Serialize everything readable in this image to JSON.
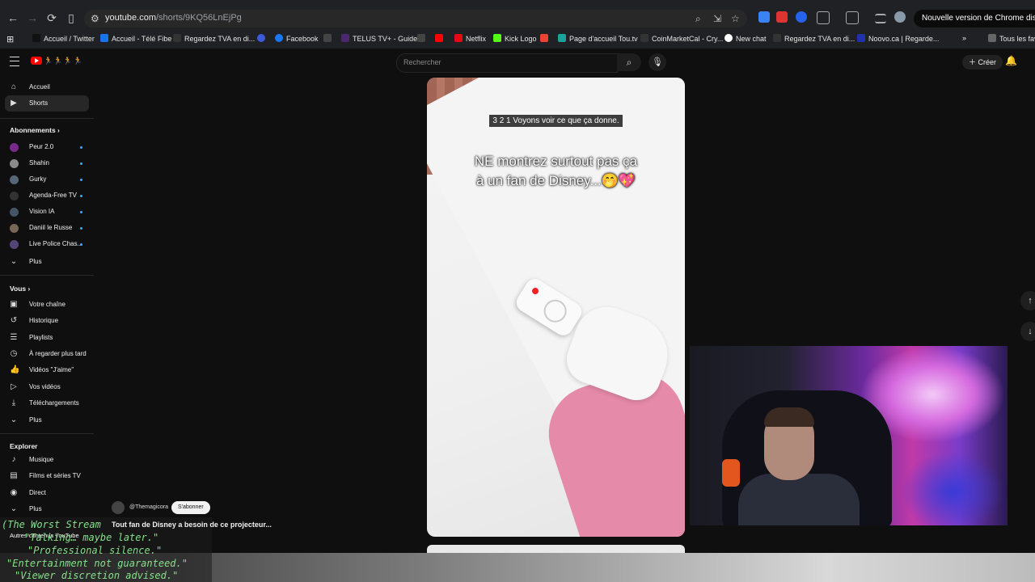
{
  "browser": {
    "url_host": "youtube.com",
    "url_path": "/shorts/9KQ56LnEjPg",
    "update_label": "Nouvelle version de Chrome disponible",
    "bookmarks": [
      {
        "label": "Accueil / Twitter",
        "color": "#111111"
      },
      {
        "label": "Accueil - Télé Fibe",
        "color": "#1a73e8"
      },
      {
        "label": "Regardez TVA en di...",
        "color": "#333333"
      },
      {
        "label": "Facebook",
        "color": "#1877f2"
      },
      {
        "label": "TELUS TV+ - Guide",
        "color": "#4b286d"
      },
      {
        "label": "Netflix",
        "color": "#e50914"
      },
      {
        "label": "Kick Logo",
        "color": "#53fc18"
      },
      {
        "label": "Page d'accueil Tou.tv",
        "color": "#1aa39a"
      },
      {
        "label": "CoinMarketCal - Cry...",
        "color": "#333333"
      },
      {
        "label": "New chat",
        "color": "#ffffff"
      },
      {
        "label": "Regardez TVA en di...",
        "color": "#333333"
      },
      {
        "label": "Noovo.ca | Regarde...",
        "color": "#2233aa"
      },
      {
        "label": "Tous les favo",
        "color": "#666666"
      }
    ]
  },
  "yt": {
    "search_placeholder": "Rechercher",
    "create_label": "Créer",
    "sidebar": {
      "main": [
        {
          "label": "Accueil",
          "icon": "home-icon"
        },
        {
          "label": "Shorts",
          "icon": "shorts-icon",
          "active": true
        }
      ],
      "subs_title": "Abonnements",
      "subs": [
        {
          "label": "Peur 2.0",
          "color": "#7a2a8a"
        },
        {
          "label": "Shahin",
          "color": "#8a8a8a"
        },
        {
          "label": "Gurky",
          "color": "#556677"
        },
        {
          "label": "Agenda-Free TV",
          "color": "#333333"
        },
        {
          "label": "Vision IA",
          "color": "#445566"
        },
        {
          "label": "Daniil le Russe",
          "color": "#776655"
        },
        {
          "label": "Live Police Chas...",
          "color": "#554477"
        }
      ],
      "more_label": "Plus",
      "you_title": "Vous",
      "you": [
        {
          "label": "Votre chaîne",
          "icon": "channel-icon"
        },
        {
          "label": "Historique",
          "icon": "history-icon"
        },
        {
          "label": "Playlists",
          "icon": "playlist-icon"
        },
        {
          "label": "À regarder plus tard",
          "icon": "clock-icon"
        },
        {
          "label": "Vidéos \"J'aime\"",
          "icon": "like-icon"
        },
        {
          "label": "Vos vidéos",
          "icon": "video-icon"
        },
        {
          "label": "Téléchargements",
          "icon": "download-icon"
        }
      ],
      "more_label2": "Plus",
      "explore_title": "Explorer",
      "explore": [
        {
          "label": "Musique",
          "icon": "music-icon"
        },
        {
          "label": "Films et séries TV",
          "icon": "film-icon"
        },
        {
          "label": "Direct",
          "icon": "live-icon"
        }
      ],
      "more_label3": "Plus",
      "other_title": "Autres contenus YouTube"
    },
    "short": {
      "caption_small": "3 2 1 Voyons voir ce que ça donne.",
      "caption_big_1": "NE montrez surtout pas ça",
      "caption_big_2": "à un fan de Disney...🤭💖",
      "channel": "@Themagicora",
      "subscribe_label": "S'abonner",
      "title": "Tout fan de Disney a besoin de ce projecteur..."
    }
  },
  "overlay": {
    "lines": [
      "(The Worst Stream",
      "\"Talking… maybe later.\"",
      "\"Professional silence.\"",
      "\"Entertainment not guaranteed.\"",
      "\"Viewer discretion advised.\""
    ]
  }
}
